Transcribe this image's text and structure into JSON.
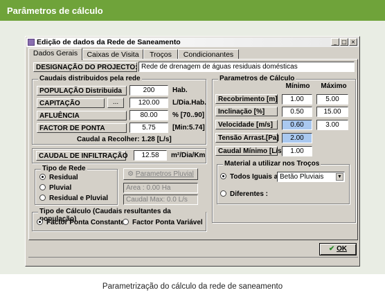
{
  "page": {
    "header": "Parâmetros de cálculo",
    "caption": "Parametrização do cálculo da rede de saneamento"
  },
  "window": {
    "title": "Edição de dados da Rede de Saneamento",
    "controls": {
      "minimize": "_",
      "maximize": "□",
      "close": "×"
    },
    "tabs": [
      "Dados Gerais",
      "Caixas de Visita",
      "Troços",
      "Condicionantes"
    ]
  },
  "designacao": {
    "label": "DESIGNAÇÃO DO PROJECTO:",
    "value": "Rede de drenagem de águas residuais domésticas"
  },
  "caudais": {
    "title": "Caudais distribuidos pela rede",
    "populacao": {
      "label": "POPULAÇÃO Distribuida",
      "value": "200",
      "unit": "Hab."
    },
    "capitacao": {
      "label": "CAPITAÇÃO",
      "button": "...",
      "value": "120.00",
      "unit": "L/Dia.Hab."
    },
    "afluencia": {
      "label": "AFLUÊNCIA",
      "value": "80.00",
      "unit": "% [70..90]"
    },
    "factor": {
      "label": "FACTOR DE PONTA",
      "value": "5.75",
      "unit": "[Min:5.74]"
    },
    "recolher": "Caudal a Recolher: 1.28 [L/s]"
  },
  "infiltracao": {
    "label": "CAUDAL DE INFILTRAÇÃO",
    "value": "12.58",
    "unit": "m²/Dia/Km"
  },
  "tipo_rede": {
    "title": "Tipo de Rede",
    "options": [
      "Residual",
      "Pluvial",
      "Residual e Pluvial"
    ],
    "selected": "Residual"
  },
  "pluvial": {
    "button": "Parametros Pluvial",
    "area": "Area : 0.00 Ha",
    "caudal": "Caudal Max: 0.0 L/s"
  },
  "tipo_calculo": {
    "title": "Tipo de Cálculo (Caudais resultantes da população)",
    "options": [
      "Factor Ponta Constante",
      "Factor Ponta Variável"
    ],
    "selected": "Factor Ponta Constante"
  },
  "parametros": {
    "title": "Parametros de Cálculo",
    "col_min": "Mínimo",
    "col_max": "Máximo",
    "rows": [
      {
        "label": "Recobrimento [m]",
        "min": "1.00",
        "max": "5.00"
      },
      {
        "label": "Inclinação [%]",
        "min": "0.50",
        "max": "15.00"
      },
      {
        "label": "Velocidade [m/s]",
        "min": "0.60",
        "max": "3.00"
      },
      {
        "label": "Tensão Arrast.[Pa]",
        "min": "2.00",
        "max": ""
      },
      {
        "label": "Caudal Mínimo [L/s]",
        "min": "1.00",
        "max": ""
      }
    ]
  },
  "material": {
    "title": "Material a utilizar nos Troços",
    "todos": "Todos Iguais a:",
    "select_value": "Betão Pluviais",
    "diferentes": "Diferentes :",
    "selected": "Todos Iguais a:"
  },
  "ok_button": "OK"
}
